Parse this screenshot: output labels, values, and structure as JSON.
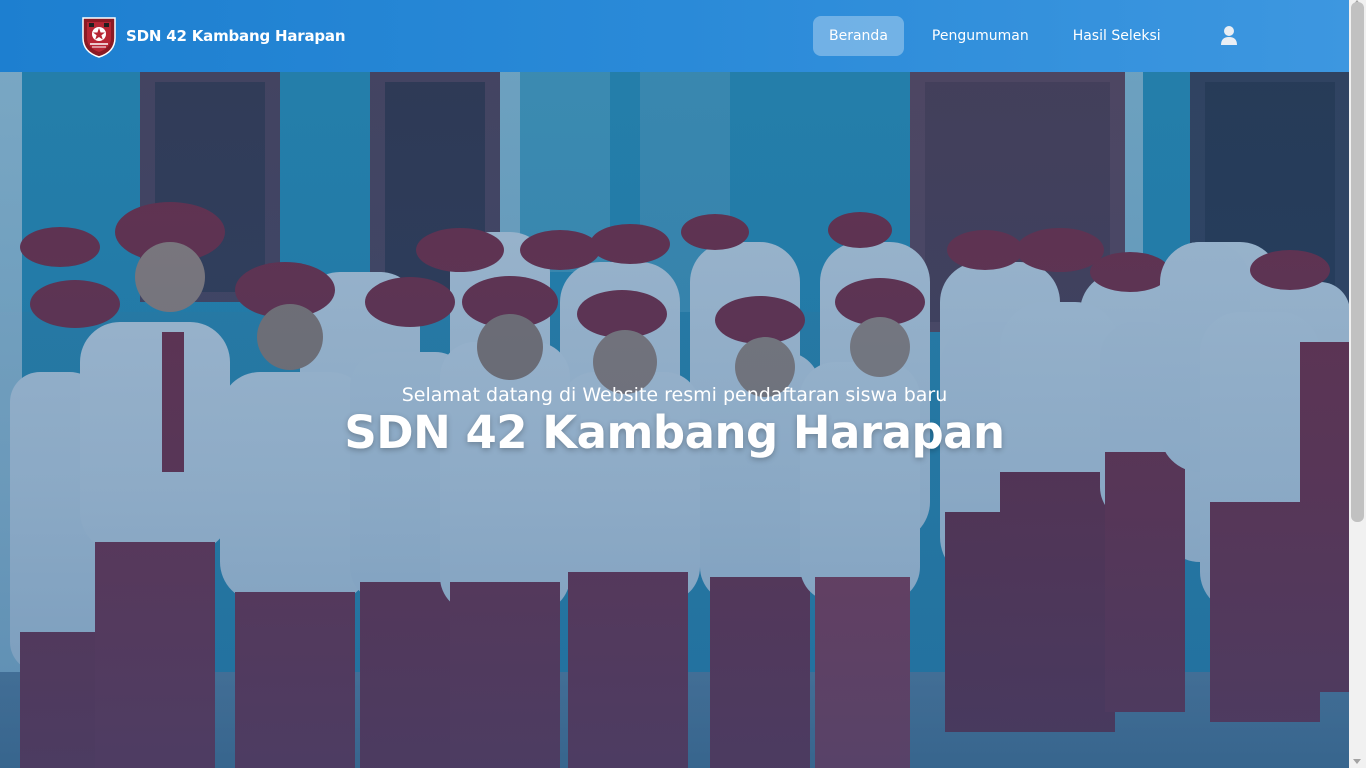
{
  "brand": {
    "name": "SDN 42 Kambang Harapan",
    "logo": "school-emblem"
  },
  "nav": {
    "items": [
      {
        "label": "Beranda",
        "active": true
      },
      {
        "label": "Pengumuman",
        "active": false
      },
      {
        "label": "Hasil Seleksi",
        "active": false
      }
    ],
    "user_icon": "user-icon"
  },
  "hero": {
    "subtitle": "Selamat datang di Website resmi pendaftaran siswa baru",
    "title": "SDN 42 Kambang Harapan",
    "background": "photo-students-in-uniform"
  },
  "colors": {
    "navbar_start": "#1d7fd0",
    "navbar_end": "#3d97e0",
    "overlay": "#18548c",
    "uniform_red": "#8b1e2d",
    "uniform_white": "#e8eef3"
  }
}
